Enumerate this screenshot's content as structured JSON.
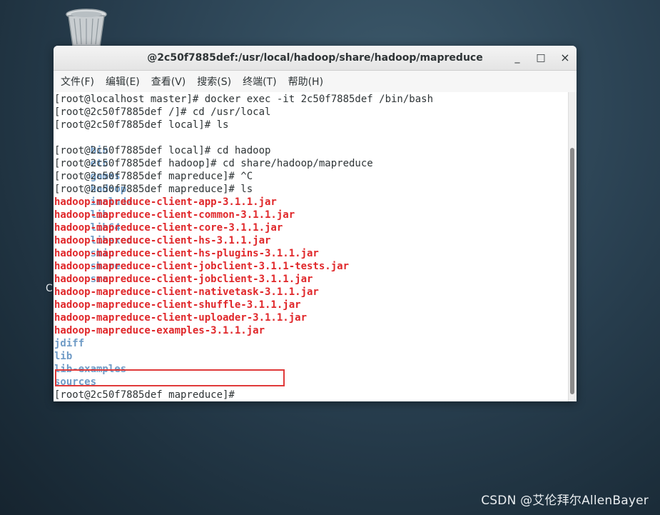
{
  "window": {
    "title": "@2c50f7885def:/usr/local/hadoop/share/hadoop/mapreduce",
    "minimize_label": "_",
    "maximize_label": "□",
    "close_label": "×"
  },
  "menu": [
    "文件(F)",
    "编辑(E)",
    "查看(V)",
    "搜索(S)",
    "终端(T)",
    "帮助(H)"
  ],
  "terminal": {
    "lines": [
      "[root@localhost master]# docker exec -it 2c50f7885def /bin/bash",
      "[root@2c50f7885def /]# cd /usr/local",
      "[root@2c50f7885def local]# ls"
    ],
    "ls_local": [
      "bin",
      "etc",
      "games",
      "hadoop",
      "include",
      "lib",
      "lib64",
      "libexec",
      "sbin",
      "share",
      "src"
    ],
    "lines2": [
      "[root@2c50f7885def local]# cd hadoop",
      "[root@2c50f7885def hadoop]# cd share/hadoop/mapreduce",
      "[root@2c50f7885def mapreduce]# ^C",
      "[root@2c50f7885def mapreduce]# ls"
    ],
    "jars": [
      "hadoop-mapreduce-client-app-3.1.1.jar",
      "hadoop-mapreduce-client-common-3.1.1.jar",
      "hadoop-mapreduce-client-core-3.1.1.jar",
      "hadoop-mapreduce-client-hs-3.1.1.jar",
      "hadoop-mapreduce-client-hs-plugins-3.1.1.jar",
      "hadoop-mapreduce-client-jobclient-3.1.1-tests.jar",
      "hadoop-mapreduce-client-jobclient-3.1.1.jar",
      "hadoop-mapreduce-client-nativetask-3.1.1.jar",
      "hadoop-mapreduce-client-shuffle-3.1.1.jar",
      "hadoop-mapreduce-client-uploader-3.1.1.jar",
      "hadoop-mapreduce-examples-3.1.1.jar"
    ],
    "dirs": [
      "jdiff",
      "lib",
      "lib-examples",
      "sources"
    ],
    "prompt": "[root@2c50f7885def mapreduce]# "
  },
  "desktop": {
    "partial_label": "C",
    "watermark": "CSDN @艾伦拜尔AllenBayer"
  },
  "colors": {
    "directory": "#6f9bc6",
    "jar_file": "#e0272a",
    "highlight_box": "#e03a3a"
  },
  "icons": [
    "trash-icon"
  ]
}
